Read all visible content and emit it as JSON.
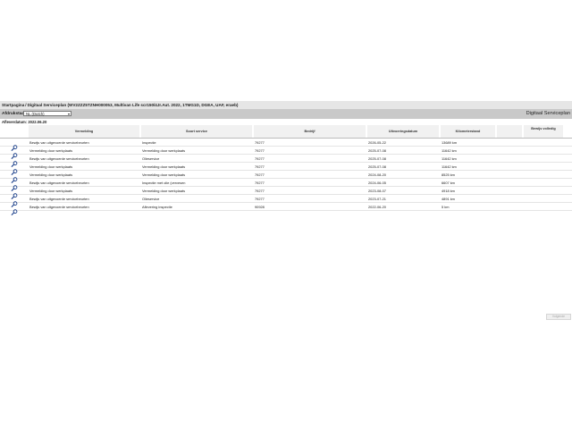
{
  "breadcrumb": {
    "home": "Startpagina",
    "current": "Digitaal Serviceplan (WV2ZZZ5TZNH000053, Multivan Life scr150/4Jr.Aut. 2022, 1TMG1D, DGEA, UAF, eraeb)"
  },
  "toolbar": {
    "afdrukstaal_label": "Afdrukstaal:",
    "language_selected": "NL (Dutch)",
    "title": "Digitaal Serviceplan"
  },
  "date_line": "Afleverdatum: 2022.06.20",
  "table": {
    "headers": [
      "Vermelding",
      "Soort service",
      "Bedrijf",
      "Uitvoeringsdatum",
      "Kilometerstand",
      "",
      "Bewijs volledig"
    ],
    "rows": [
      {
        "vermelding": "Bewijs van uitgevoerde servicebeurten",
        "soort": "Inspectie",
        "bedrijf": "79277",
        "datum": "2026-05-22",
        "km": "13689 km"
      },
      {
        "vermelding": "Vermelding door werkplaats",
        "soort": "Vermelding door werkplaats",
        "bedrijf": "79277",
        "datum": "2025-07-08",
        "km": "11642 km"
      },
      {
        "vermelding": "Bewijs van uitgevoerde servicebeurten",
        "soort": "Olieservice",
        "bedrijf": "79277",
        "datum": "2025-07-08",
        "km": "11642 km"
      },
      {
        "vermelding": "Vermelding door werkplaats",
        "soort": "Vermelding door werkplaats",
        "bedrijf": "79277",
        "datum": "2025-07-08",
        "km": "11642 km"
      },
      {
        "vermelding": "Vermelding door werkplaats",
        "soort": "Vermelding door werkplaats",
        "bedrijf": "79277",
        "datum": "2024-08-20",
        "km": "8525 km"
      },
      {
        "vermelding": "Bewijs van uitgevoerde servicebeurten",
        "soort": "Inspectie met olie (vervesen",
        "bedrijf": "79277",
        "datum": "2024-06-05",
        "km": "6607 km"
      },
      {
        "vermelding": "Vermelding door werkplaats",
        "soort": "Vermelding door werkplaats",
        "bedrijf": "79277",
        "datum": "2023-08-07",
        "km": "4918 km"
      },
      {
        "vermelding": "Bewijs van uitgevoerde servicebeurten",
        "soort": "Olieservice",
        "bedrijf": "79277",
        "datum": "2023-07-21",
        "km": "4891 km"
      },
      {
        "vermelding": "Bewijs van uitgevoerde servicebeurten",
        "soort": "Aflevering inspectie",
        "bedrijf": "90928",
        "datum": "2022-06-20",
        "km": "5 km"
      }
    ]
  },
  "next_label": "Volgende",
  "colors": {
    "breadcrumb_bg": "#e6e6e6",
    "toolbar_bg": "#c9c9c9",
    "header_bg": "#f1f1f1",
    "icon": "#1a3f8a"
  }
}
